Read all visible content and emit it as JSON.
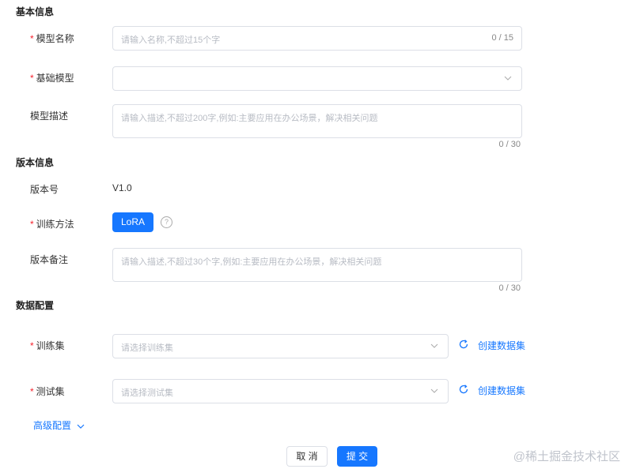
{
  "sections": {
    "basic": "基本信息",
    "version": "版本信息",
    "data": "数据配置"
  },
  "fields": {
    "model_name": {
      "label": "模型名称",
      "placeholder": "请输入名称,不超过15个字",
      "count": "0 / 15"
    },
    "base_model": {
      "label": "基础模型",
      "value": ""
    },
    "model_desc": {
      "label": "模型描述",
      "placeholder": "请输入描述,不超过200字,例如:主要应用在办公场景，解决相关问题",
      "count": "0 / 30"
    },
    "version_no": {
      "label": "版本号",
      "value": "V1.0"
    },
    "train_method": {
      "label": "训练方法",
      "option": "LoRA",
      "help": "?"
    },
    "version_note": {
      "label": "版本备注",
      "placeholder": "请输入描述,不超过30个字,例如:主要应用在办公场景，解决相关问题",
      "count": "0 / 30"
    },
    "train_set": {
      "label": "训练集",
      "placeholder": "请选择训练集",
      "create_link": "创建数据集"
    },
    "test_set": {
      "label": "测试集",
      "placeholder": "请选择测试集",
      "create_link": "创建数据集"
    }
  },
  "advanced": {
    "label": "高级配置"
  },
  "footer": {
    "cancel": "取 消",
    "submit": "提 交"
  },
  "watermark": "@稀土掘金技术社区",
  "colors": {
    "primary": "#1677ff",
    "required": "#f5222d",
    "border": "#dcdfe6"
  },
  "icons": {
    "dropdown": "chevron-down-icon",
    "refresh": "refresh-icon",
    "help": "question-circle-icon"
  }
}
